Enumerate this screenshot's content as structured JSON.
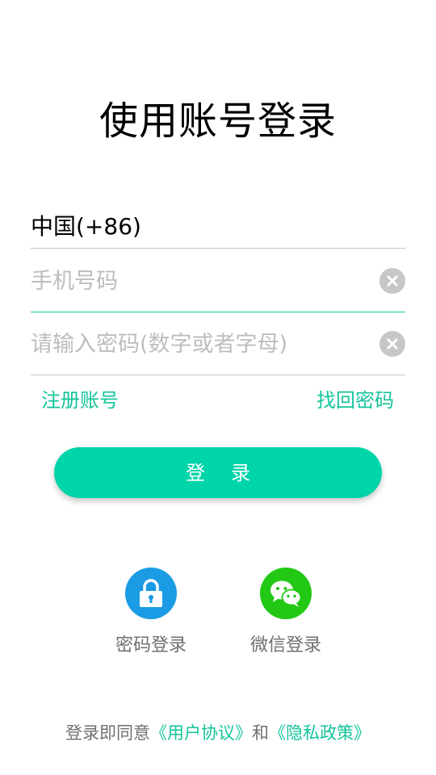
{
  "page": {
    "title": "使用账号登录"
  },
  "form": {
    "country_code": "中国(+86)",
    "phone_placeholder": "手机号码",
    "phone_value": "",
    "password_placeholder": "请输入密码(数字或者字母)",
    "password_value": ""
  },
  "links": {
    "register": "注册账号",
    "forgot_password": "找回密码"
  },
  "login_button": {
    "label": "登录"
  },
  "alt_login": {
    "password_label": "密码登录",
    "wechat_label": "微信登录"
  },
  "agreement": {
    "prefix": "登录即同意",
    "user_agreement": "《用户协议》",
    "conjunction": "和",
    "privacy_policy": "《隐私政策》"
  },
  "colors": {
    "accent": "#00d4a9",
    "link": "#13c49a",
    "lock_icon_bg": "#1a9be4",
    "wechat_icon_bg": "#22c814",
    "clear_icon_bg": "#c7c7c7"
  },
  "icons": {
    "clear": "close-circle-icon",
    "password_login": "lock-icon",
    "wechat_login": "wechat-icon"
  }
}
